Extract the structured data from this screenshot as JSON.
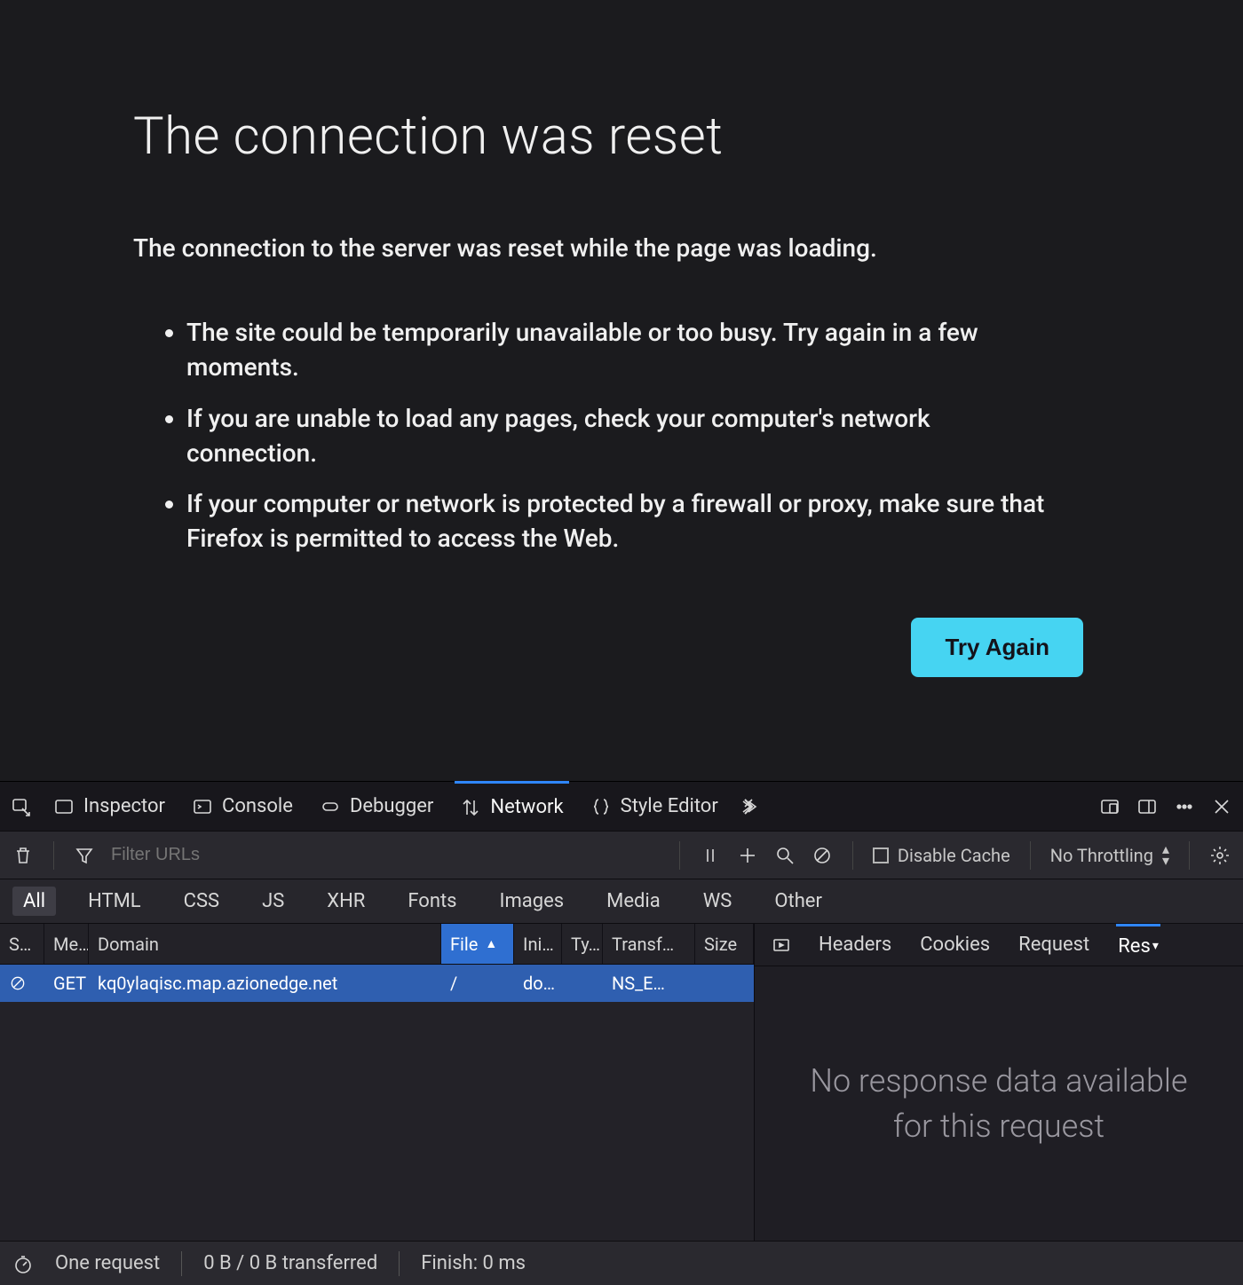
{
  "error": {
    "title": "The connection was reset",
    "subtitle": "The connection to the server was reset while the page was loading.",
    "bullets": [
      "The site could be temporarily unavailable or too busy. Try again in a few moments.",
      "If you are unable to load any pages, check your computer's network connection.",
      "If your computer or network is protected by a firewall or proxy, make sure that Firefox is permitted to access the Web."
    ],
    "retry_label": "Try Again"
  },
  "devtools": {
    "panels": {
      "inspector": "Inspector",
      "console": "Console",
      "debugger": "Debugger",
      "network": "Network",
      "styleeditor": "Style Editor"
    },
    "network_toolbar": {
      "filter_placeholder": "Filter URLs",
      "disable_cache_label": "Disable Cache",
      "throttling_label": "No Throttling"
    },
    "filter_chips": [
      "All",
      "HTML",
      "CSS",
      "JS",
      "XHR",
      "Fonts",
      "Images",
      "Media",
      "WS",
      "Other"
    ],
    "columns": {
      "status": "S…",
      "method": "Me…",
      "domain": "Domain",
      "file": "File",
      "initiator": "Ini…",
      "type": "Ty…",
      "transferred": "Transf…",
      "size": "Size"
    },
    "sorted_column": "file",
    "rows": [
      {
        "status_icon": "blocked",
        "method": "GET",
        "domain": "kq0ylaqisc.map.azionedge.net",
        "file": "/",
        "initiator": "do…",
        "type": "",
        "transferred": "NS_E…",
        "size": ""
      }
    ],
    "details": {
      "tabs": [
        "Headers",
        "Cookies",
        "Request",
        "Res"
      ],
      "active_tab": 3,
      "empty_message": "No response data available for this request"
    },
    "status_bar": {
      "requests": "One request",
      "transferred": "0 B / 0 B transferred",
      "finish": "Finish: 0 ms"
    }
  }
}
